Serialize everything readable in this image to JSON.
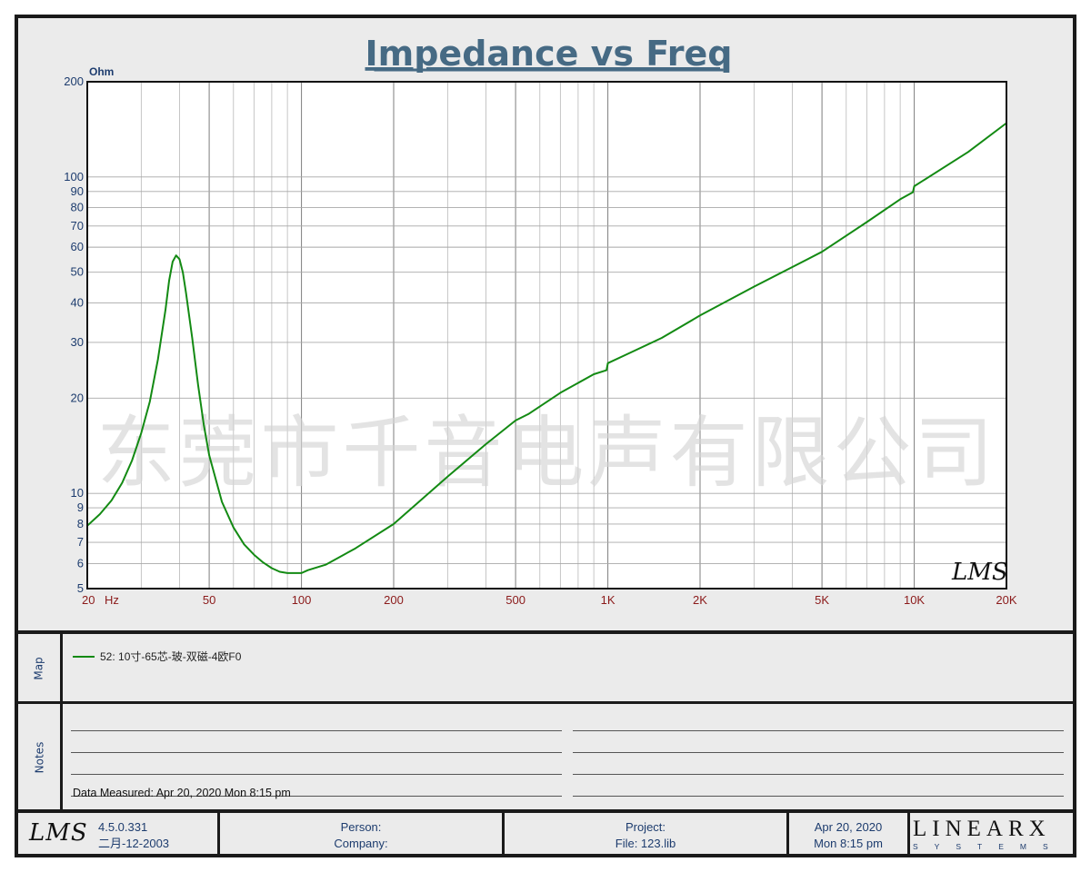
{
  "chart_data": {
    "type": "line",
    "title": "Impedance vs Freq",
    "ylabel": "Ohm",
    "xlabel": "",
    "x_scale": "log",
    "y_scale": "log",
    "xlim": [
      20,
      20000
    ],
    "ylim": [
      5,
      200
    ],
    "x_ticks": [
      {
        "v": 20,
        "t": "20"
      },
      {
        "v": 50,
        "t": "50"
      },
      {
        "v": 100,
        "t": "100"
      },
      {
        "v": 200,
        "t": "200"
      },
      {
        "v": 500,
        "t": "500"
      },
      {
        "v": 1000,
        "t": "1K"
      },
      {
        "v": 2000,
        "t": "2K"
      },
      {
        "v": 5000,
        "t": "5K"
      },
      {
        "v": 10000,
        "t": "10K"
      },
      {
        "v": 20000,
        "t": "20K"
      }
    ],
    "x_unit": "Hz",
    "y_ticks": [
      5,
      6,
      7,
      8,
      9,
      10,
      20,
      30,
      40,
      50,
      60,
      70,
      80,
      90,
      100,
      200
    ],
    "grid": true,
    "watermark": "东莞市千音电声有限公司",
    "chart_logo": "LMS",
    "series": [
      {
        "name": "52: 10寸-65芯-玻-双磁-4欧F0",
        "color": "#138a13",
        "points": [
          [
            20,
            7.9
          ],
          [
            22,
            8.6
          ],
          [
            24,
            9.5
          ],
          [
            26,
            10.8
          ],
          [
            28,
            12.7
          ],
          [
            30,
            15.5
          ],
          [
            32,
            19.5
          ],
          [
            34,
            26.5
          ],
          [
            36,
            38
          ],
          [
            37,
            47
          ],
          [
            38,
            54
          ],
          [
            39,
            56.5
          ],
          [
            40,
            55
          ],
          [
            41,
            50
          ],
          [
            42,
            43
          ],
          [
            44,
            31
          ],
          [
            46,
            22
          ],
          [
            48,
            16.5
          ],
          [
            50,
            13.2
          ],
          [
            55,
            9.4
          ],
          [
            60,
            7.8
          ],
          [
            65,
            6.9
          ],
          [
            70,
            6.4
          ],
          [
            75,
            6.05
          ],
          [
            80,
            5.8
          ],
          [
            85,
            5.65
          ],
          [
            90,
            5.6
          ],
          [
            100,
            5.6
          ],
          [
            105,
            5.72
          ],
          [
            120,
            5.95
          ],
          [
            150,
            6.7
          ],
          [
            200,
            8.0
          ],
          [
            300,
            11.3
          ],
          [
            400,
            14.3
          ],
          [
            500,
            17.0
          ],
          [
            550,
            17.8
          ],
          [
            700,
            20.8
          ],
          [
            900,
            23.8
          ],
          [
            990,
            24.5
          ],
          [
            1000,
            25.8
          ],
          [
            1200,
            28.0
          ],
          [
            1500,
            31.0
          ],
          [
            2000,
            36.5
          ],
          [
            3000,
            45.0
          ],
          [
            5000,
            58.0
          ],
          [
            7000,
            72.0
          ],
          [
            9000,
            85.0
          ],
          [
            9900,
            89.5
          ],
          [
            10000,
            93.5
          ],
          [
            15000,
            120
          ],
          [
            20000,
            148
          ]
        ]
      }
    ]
  },
  "map_panel": {
    "label": "Map",
    "legend_text": "52: 10寸-65芯-玻-双磁-4欧F0"
  },
  "notes_panel": {
    "label": "Notes",
    "data_measured": "Data Measured: Apr 20, 2020  Mon  8:15 pm"
  },
  "footer": {
    "logo_text": "LMS",
    "version": "4.5.0.331",
    "build_date": "二月-12-2003",
    "person_label": "Person:",
    "company_label": "Company:",
    "project_label": "Project:",
    "file_label": "File: 123.lib",
    "date": "Apr 20, 2020",
    "time": "Mon  8:15 pm",
    "brand_top": "LINEARX",
    "brand_bottom": "SYSTEMS"
  }
}
